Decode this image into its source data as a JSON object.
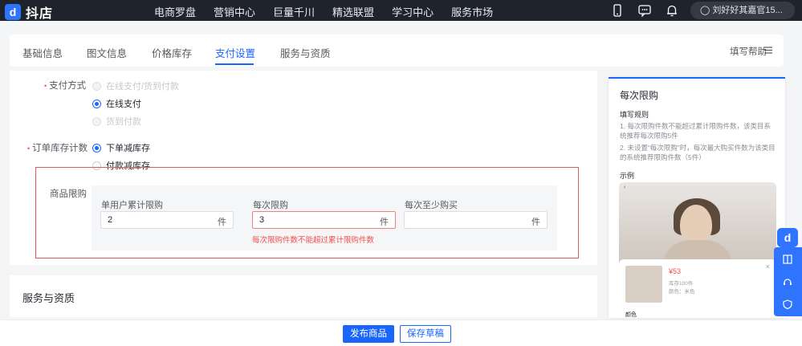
{
  "app": {
    "logo_mark": "d",
    "logo_text": "抖店"
  },
  "topnav": {
    "items": [
      "电商罗盘",
      "营销中心",
      "巨量千川",
      "精选联盟",
      "学习中心",
      "服务市场"
    ],
    "user": "刘好好其嘉官15...",
    "icons": [
      "phone-icon",
      "message-icon",
      "bell-icon",
      "user-icon"
    ]
  },
  "tabs": {
    "items": [
      "基础信息",
      "图文信息",
      "价格库存",
      "支付设置",
      "服务与资质"
    ],
    "active": "支付设置",
    "help": "填写帮助"
  },
  "payment": {
    "label": "支付方式",
    "options": [
      {
        "text": "在线支付/货到付款",
        "state": "disabled"
      },
      {
        "text": "在线支付",
        "state": "checked"
      },
      {
        "text": "货到付款",
        "state": "disabled"
      }
    ]
  },
  "stock": {
    "label": "订单库存计数",
    "options": [
      {
        "text": "下单减库存",
        "state": "checked"
      },
      {
        "text": "付款减库存",
        "state": "unchecked"
      }
    ]
  },
  "limit": {
    "label": "商品限购",
    "fields": [
      {
        "label": "单用户累计限购",
        "value": "2",
        "unit": "件"
      },
      {
        "label": "每次限购",
        "value": "3",
        "unit": "件"
      },
      {
        "label": "每次至少购买",
        "value": "",
        "unit": "件"
      }
    ],
    "error": "每次限购件数不能超过累计限购件数"
  },
  "services": {
    "title": "服务与资质"
  },
  "actions": {
    "publish": "发布商品",
    "save_draft": "保存草稿"
  },
  "help_panel": {
    "title": "每次限购",
    "rules_title": "填写规则",
    "rules": [
      "1. 每次限购件数不能超过累计限购件数，该类目系统推荐每次限购5件",
      "2. 未设置“每次限购”时，每次最大购买件数为该类目的系统推荐限购件数（5件）"
    ],
    "example_title": "示例",
    "example": {
      "price": "¥53",
      "line1": "库存100件",
      "line2": "颜色：米色",
      "footer": "颜色"
    }
  },
  "colors": {
    "primary": "#1966ff",
    "nav_bg": "#1f232c",
    "error": "#f54d4d",
    "highlight_box": "#e05a5a"
  }
}
